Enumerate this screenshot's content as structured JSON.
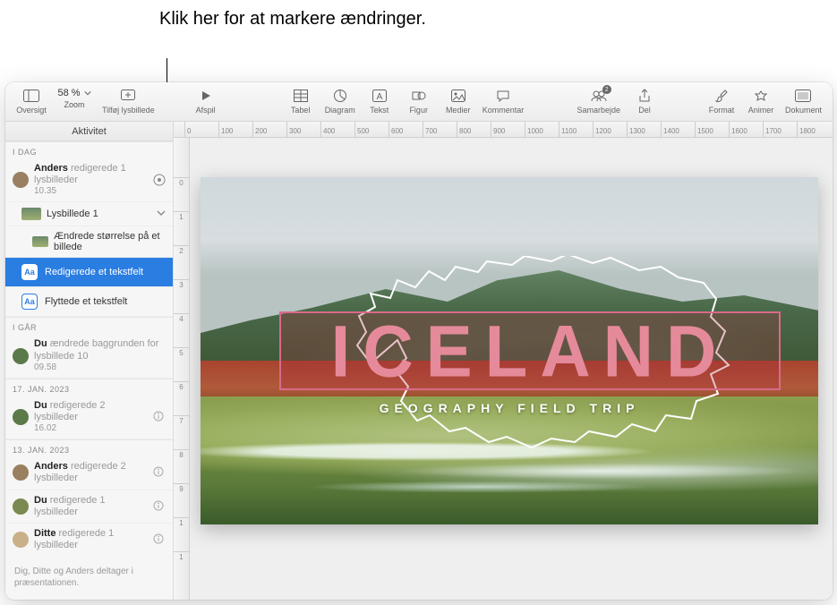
{
  "callout": "Klik her for at markere ændringer.",
  "toolbar": {
    "overview": "Oversigt",
    "zoom_label": "Zoom",
    "zoom_value": "58 %",
    "add_slide": "Tilføj lysbillede",
    "play": "Afspil",
    "table": "Tabel",
    "chart": "Diagram",
    "text": "Tekst",
    "shape": "Figur",
    "media": "Medier",
    "comment": "Kommentar",
    "collaborate": "Samarbejde",
    "collaborate_badge": "2",
    "share": "Del",
    "format": "Format",
    "animate": "Animer",
    "document": "Dokument"
  },
  "sidebar": {
    "title": "Aktivitet",
    "sections": {
      "today": "I DAG",
      "yesterday": "I GÅR",
      "jan17": "17. JAN. 2023",
      "jan13": "13. JAN. 2023"
    },
    "today_entry": {
      "user": "Anders",
      "action": "redigerede 1 lysbilleder",
      "time": "10.35"
    },
    "slide_name": "Lysbillede 1",
    "change_resize": "Ændrede størrelse på et billede",
    "action_edit": "Redigerede et tekstfelt",
    "action_move": "Flyttede et tekstfelt",
    "yesterday_entry": {
      "user": "Du",
      "action": "ændrede baggrunden for lysbillede 10",
      "time": "09.58"
    },
    "jan17_entry": {
      "user": "Du",
      "action": "redigerede 2 lysbilleder",
      "time": "16.02"
    },
    "jan13_entries": [
      {
        "user": "Anders",
        "action": "redigerede 2 lysbilleder"
      },
      {
        "user": "Du",
        "action": "redigerede 1 lysbilleder"
      },
      {
        "user": "Ditte",
        "action": "redigerede 1 lysbilleder"
      }
    ],
    "footer": "Dig, Ditte og Anders deltager i præsentationen."
  },
  "ruler": {
    "h": [
      "0",
      "100",
      "200",
      "300",
      "400",
      "500",
      "600",
      "700",
      "800",
      "900",
      "1000",
      "1100",
      "1200",
      "1300",
      "1400",
      "1500",
      "1600",
      "1700",
      "1800"
    ],
    "v": [
      "0",
      "1",
      "2",
      "3",
      "4",
      "5",
      "6",
      "7",
      "8",
      "9",
      "1",
      "1"
    ]
  },
  "slide": {
    "title": "ICELAND",
    "subtitle": "GEOGRAPHY FIELD TRIP"
  }
}
